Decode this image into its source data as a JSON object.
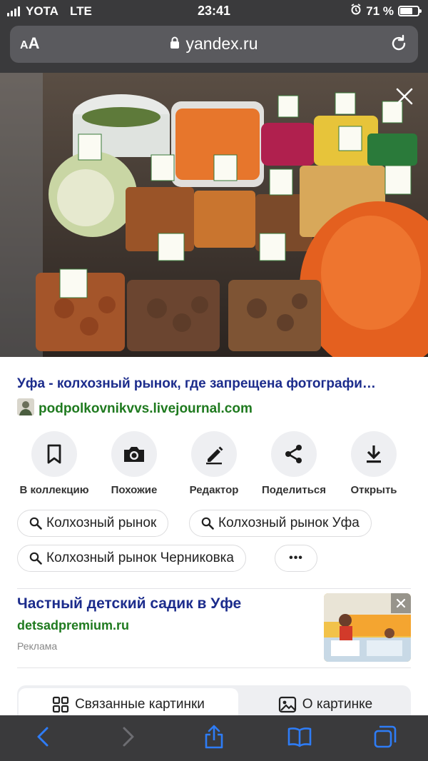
{
  "status_bar": {
    "carrier": "YOTA",
    "network": "LTE",
    "time": "23:41",
    "battery": "71 %",
    "battery_level": 0.71
  },
  "browser": {
    "aa_label": "AA",
    "url": "yandex.ru"
  },
  "result": {
    "title": "Уфа - колхозный рынок, где запрещена фотографи…",
    "source": "podpolkovnikvvs.livejournal.com"
  },
  "actions": [
    {
      "label": "В коллекцию",
      "icon": "bookmark-icon"
    },
    {
      "label": "Похожие",
      "icon": "camera-icon"
    },
    {
      "label": "Редактор",
      "icon": "pencil-icon"
    },
    {
      "label": "Поделиться",
      "icon": "share-icon"
    },
    {
      "label": "Открыть",
      "icon": "download-icon"
    }
  ],
  "related_searches": [
    "Колхозный рынок",
    "Колхозный рынок Уфа",
    "Колхозный рынок Черниковка"
  ],
  "more_label": "•••",
  "ad": {
    "title": "Частный детский садик в Уфе",
    "domain": "detsadpremium.ru",
    "label": "Реклама"
  },
  "tabs": {
    "related": "Связанные картинки",
    "about": "О картинке"
  },
  "colors": {
    "link_blue": "#1c2c8c",
    "source_green": "#1f7a1f",
    "chrome_dark": "#3a3a3c",
    "toolbar_icon_blue": "#2e7cf6"
  }
}
